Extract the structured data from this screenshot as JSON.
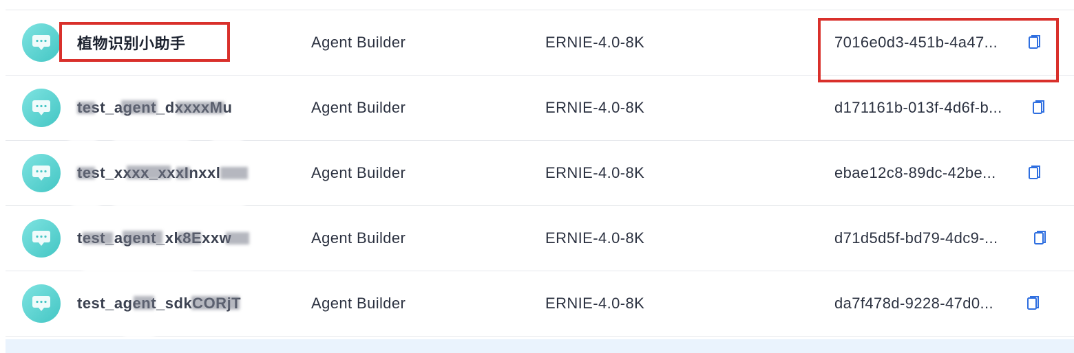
{
  "rows": [
    {
      "name": "植物识别小助手",
      "type": "Agent Builder",
      "model": "ERNIE-4.0-8K",
      "app_id": "7016e0d3-451b-4a47...",
      "highlighted": true
    },
    {
      "name": "test_agent_dxxxxMu",
      "type": "Agent Builder",
      "model": "ERNIE-4.0-8K",
      "app_id": "d171161b-013f-4d6f-b...",
      "highlighted": false
    },
    {
      "name": "test_xxxx_xxxInxxl",
      "type": "Agent Builder",
      "model": "ERNIE-4.0-8K",
      "app_id": "ebae12c8-89dc-42be...",
      "highlighted": false
    },
    {
      "name": "test_agent_xk8Exxw",
      "type": "Agent Builder",
      "model": "ERNIE-4.0-8K",
      "app_id": "d71d5d5f-bd79-4dc9-...",
      "highlighted": false
    },
    {
      "name": "test_agent_sdkCORjT",
      "type": "Agent Builder",
      "model": "ERNIE-4.0-8K",
      "app_id": "da7f478d-9228-47d0...",
      "highlighted": false
    }
  ],
  "icons": {
    "avatar": "chat-bubble-icon",
    "copy": "copy-icon"
  },
  "colors": {
    "avatar_gradient_start": "#7ee3e1",
    "avatar_gradient_end": "#44c6c4",
    "copy_icon": "#2f6fe0",
    "highlight_border": "#d9302b",
    "row_divider": "#e5e7eb",
    "selected_strip": "#eaf3fd"
  }
}
